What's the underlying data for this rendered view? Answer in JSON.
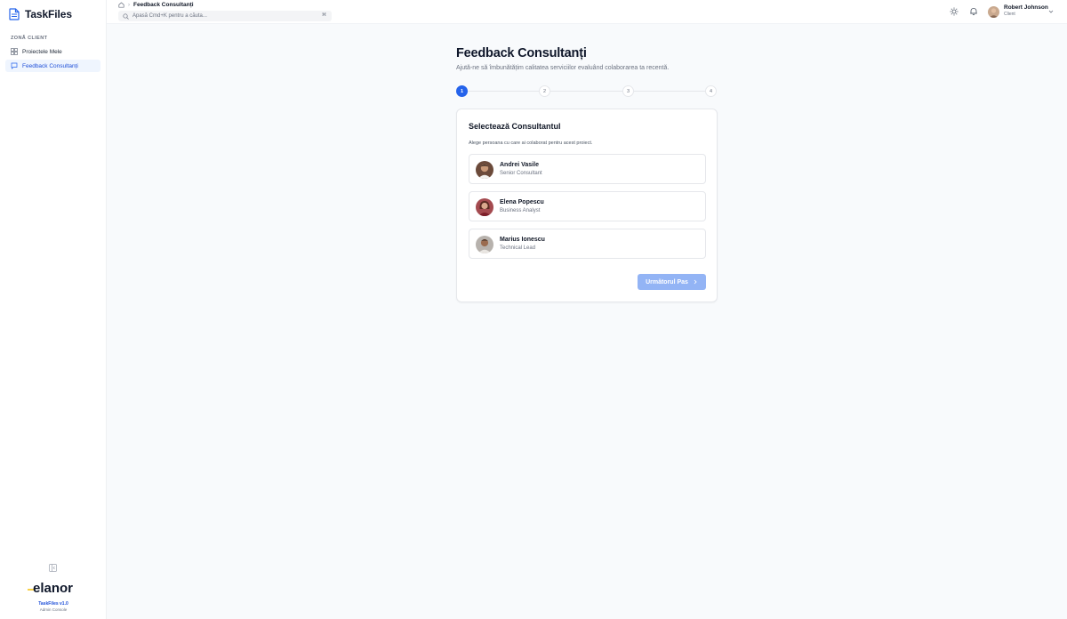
{
  "app": {
    "name": "TaskFiles"
  },
  "sidebar": {
    "section_label": "ZONĂ CLIENT",
    "items": [
      {
        "label": "Proiectele Mele",
        "icon": "grid-icon",
        "active": false
      },
      {
        "label": "Feedback Consultanți",
        "icon": "chat-icon",
        "active": true
      }
    ],
    "footer": {
      "version": "TaskFiles v1.0",
      "console": "Admin Console"
    }
  },
  "topbar": {
    "breadcrumb": {
      "current": "Feedback Consultanți"
    },
    "search": {
      "placeholder": "Apasă Cmd+K pentru a căuta...",
      "shortcut": "⌘"
    },
    "user": {
      "name": "Robert Johnson",
      "role": "Client"
    }
  },
  "page": {
    "title": "Feedback Consultanți",
    "subtitle": "Ajută-ne să îmbunătățim calitatea serviciilor evaluând colaborarea ta recentă.",
    "steps": [
      "1",
      "2",
      "3",
      "4"
    ],
    "current_step": 1
  },
  "card": {
    "title": "Selectează Consultantul",
    "description": "Alege persoana cu care ai colaborat pentru acest proiect.",
    "consultants": [
      {
        "name": "Andrei Vasile",
        "role": "Senior Consultant"
      },
      {
        "name": "Elena Popescu",
        "role": "Business Analyst"
      },
      {
        "name": "Marius Ionescu",
        "role": "Technical Lead"
      }
    ],
    "next_label": "Următorul Pas"
  },
  "colors": {
    "accent": "#2563eb",
    "accent_disabled": "#93b4f5",
    "active_nav_bg": "#eff5fe",
    "logo_accent": "#f5c518"
  }
}
